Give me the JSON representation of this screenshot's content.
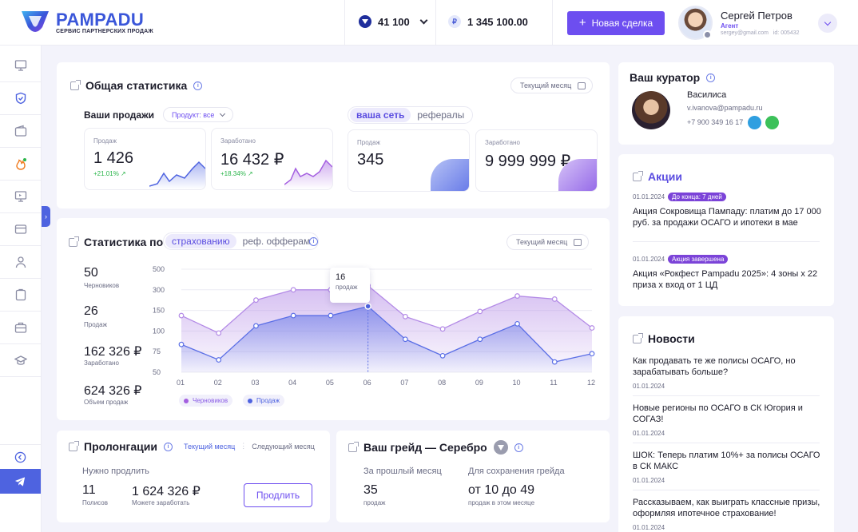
{
  "header": {
    "logo_text": "PAMPADU",
    "logo_sub": "СЕРВИС ПАРТНЕРСКИХ ПРОДАЖ",
    "points": "41 100",
    "balance": "1 345 100.00",
    "new_deal": "Новая сделка",
    "user_name": "Сергей Петров",
    "user_role": "Агент",
    "user_email": "sergey@gmail.com",
    "user_id": "id: 005432"
  },
  "colors": {
    "accent": "#6d4ef0",
    "blue": "#4e63e0",
    "green": "#2ab54a"
  },
  "general": {
    "title": "Общая статистика",
    "period": "Текущий месяц",
    "sales_title": "Ваши продажи",
    "product_select": "Продукт: все",
    "seg_network": "ваша сеть",
    "seg_referrals": "рефералы",
    "cards": [
      {
        "label": "Продаж",
        "value": "1 426",
        "delta": "+21.01%"
      },
      {
        "label": "Заработано",
        "value": "16 432 ₽",
        "delta": "+18.34%"
      },
      {
        "label": "Продаж",
        "value": "345"
      },
      {
        "label": "Заработано",
        "value": "9 999 999 ₽"
      }
    ]
  },
  "statistics": {
    "title": "Статистика по",
    "seg_insurance": "страхованию",
    "seg_ref_offers": "реф. офферам",
    "period": "Текущий месяц",
    "left": [
      {
        "value": "50",
        "label": "Черновиков"
      },
      {
        "value": "26",
        "label": "Продаж"
      },
      {
        "value": "162 326 ₽",
        "label": "Заработано"
      },
      {
        "value": "624 326 ₽",
        "label": "Объем продаж"
      }
    ],
    "tooltip_value": "16",
    "tooltip_label": "продаж",
    "legend_drafts": "Черновиков",
    "legend_sales": "Продаж"
  },
  "chart_data": {
    "type": "area",
    "categories": [
      "01",
      "02",
      "03",
      "04",
      "05",
      "06",
      "07",
      "08",
      "09",
      "10",
      "11",
      "12"
    ],
    "y_ticks": [
      "500",
      "300",
      "150",
      "100",
      "75",
      "50"
    ],
    "series": [
      {
        "name": "Черновиков",
        "color": "#b38ae6",
        "values": [
          0.55,
          0.38,
          0.7,
          0.8,
          0.8,
          0.84,
          0.54,
          0.42,
          0.59,
          0.74,
          0.71,
          0.43
        ]
      },
      {
        "name": "Продаж",
        "color": "#5b6fe6",
        "values": [
          0.27,
          0.12,
          0.45,
          0.55,
          0.55,
          0.64,
          0.32,
          0.16,
          0.32,
          0.47,
          0.1,
          0.18
        ]
      }
    ],
    "highlight_index": 5
  },
  "prolong": {
    "title": "Пролонгации",
    "tab_current": "Текущий месяц",
    "tab_next": "Следующий месяц",
    "need_label": "Нужно продлить",
    "policies_value": "11",
    "policies_label": "Полисов",
    "earn_value": "1 624 326 ₽",
    "earn_label": "Можете заработать",
    "button": "Продлить"
  },
  "grade": {
    "title": "Ваш грейд — Серебро",
    "prev_label": "За прошлый месяц",
    "prev_value": "35",
    "prev_unit": "продаж",
    "keep_label": "Для сохранения грейда",
    "keep_value": "от 10 до 49",
    "keep_unit": "продаж в этом месяце"
  },
  "curator": {
    "title": "Ваш куратор",
    "name": "Василиса",
    "email": "v.ivanova@pampadu.ru",
    "phone": "+7 900 349 16 17"
  },
  "promos": {
    "title": "Акции",
    "items": [
      {
        "date": "01.01.2024",
        "tag": "До конца: 7 дней",
        "text": "Акция Сокровища Пампаду: платим до 17 000 руб. за продажи ОСАГО и ипотеки в мае"
      },
      {
        "date": "01.01.2024",
        "tag": "Акция завершена",
        "text": "Акция «Рокфест Pampadu 2025»: 4 зоны х 22 приза х вход от 1 ЦД"
      }
    ]
  },
  "news": {
    "title": "Новости",
    "items": [
      {
        "text": "Как продавать те же полисы ОСАГО, но зарабатывать больше?",
        "date": "01.01.2024"
      },
      {
        "text": "Новые регионы по ОСАГО в СК Югория и СОГАЗ!",
        "date": "01.01.2024"
      },
      {
        "text": "ШОК: Теперь платим 10%+  за полисы ОСАГО в СК МАКС",
        "date": "01.01.2024"
      },
      {
        "text": "Рассказываем, как выиграть классные призы, оформляя ипотечное страхование!",
        "date": "01.01.2024"
      }
    ]
  }
}
